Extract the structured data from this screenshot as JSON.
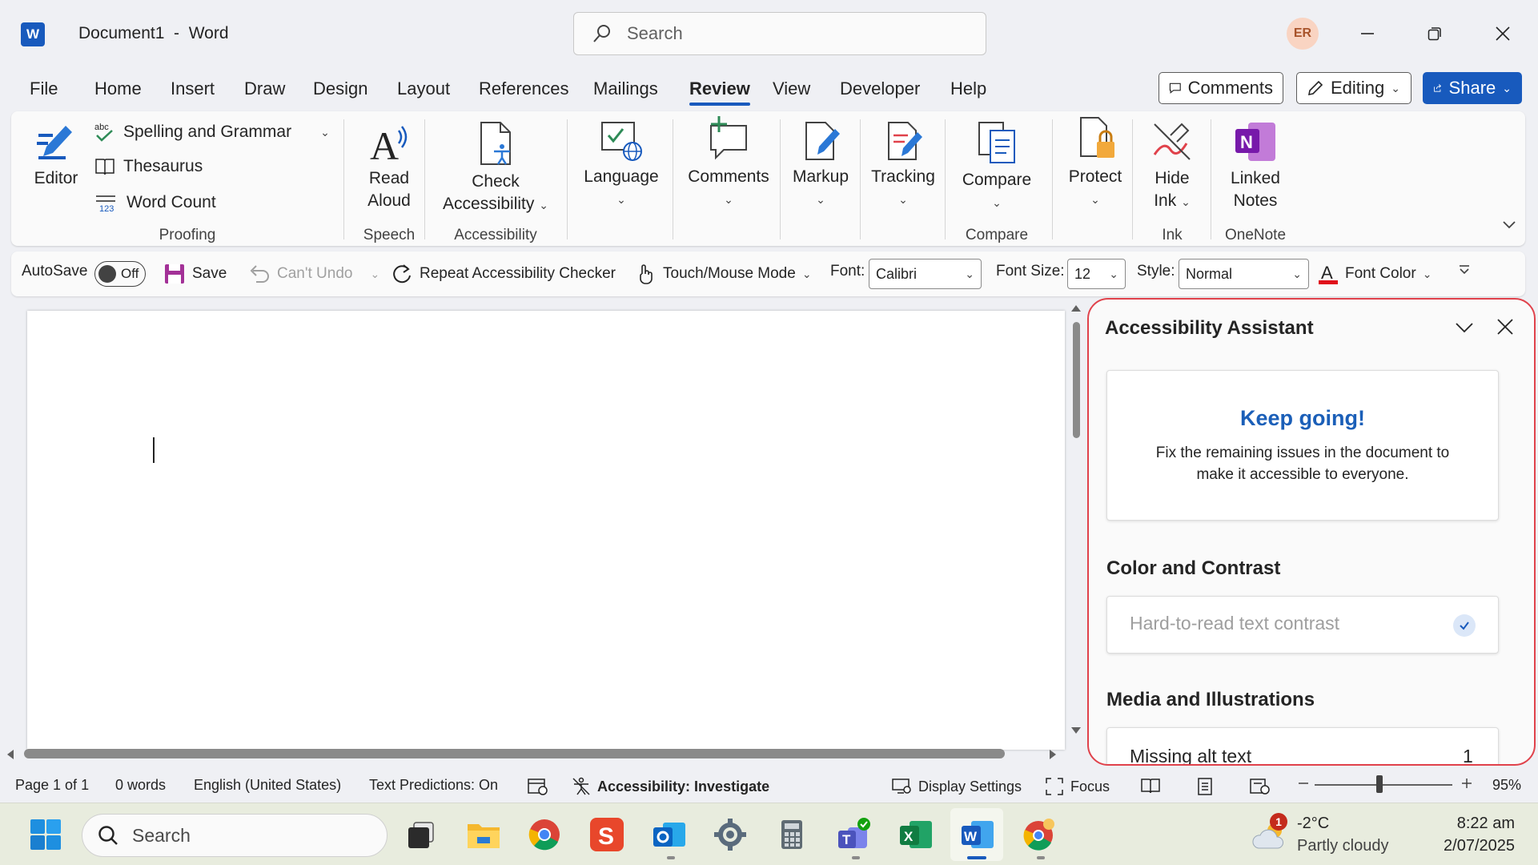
{
  "titlebar": {
    "app_logo": "W",
    "doc_title": "Document1  -  Word",
    "search_placeholder": "Search",
    "avatar": "ER"
  },
  "menu": {
    "tabs": [
      "File",
      "Home",
      "Insert",
      "Draw",
      "Design",
      "Layout",
      "References",
      "Mailings",
      "Review",
      "View",
      "Developer",
      "Help"
    ],
    "active_tab": "Review",
    "comments_label": "Comments",
    "editing_label": "Editing",
    "share_label": "Share"
  },
  "ribbon": {
    "editor": "Editor",
    "spelling": "Spelling and Grammar",
    "thesaurus": "Thesaurus",
    "word_count": "Word Count",
    "proofing": "Proofing",
    "read_aloud_1": "Read",
    "read_aloud_2": "Aloud",
    "speech": "Speech",
    "check_acc_1": "Check",
    "check_acc_2": "Accessibility",
    "accessibility": "Accessibility",
    "language": "Language",
    "comments": "Comments",
    "markup": "Markup",
    "tracking": "Tracking",
    "compare_btn": "Compare",
    "compare_group": "Compare",
    "protect": "Protect",
    "hide_ink_1": "Hide",
    "hide_ink_2": "Ink",
    "ink": "Ink",
    "linked_1": "Linked",
    "linked_2": "Notes",
    "onenote": "OneNote"
  },
  "qat": {
    "autosave": "AutoSave",
    "autosave_state": "Off",
    "save": "Save",
    "cant_undo": "Can't Undo",
    "repeat": "Repeat Accessibility Checker",
    "touch": "Touch/Mouse Mode",
    "font_label": "Font:",
    "font_value": "Calibri",
    "size_label": "Font Size:",
    "size_value": "12",
    "style_label": "Style:",
    "style_value": "Normal",
    "font_color": "Font Color"
  },
  "pane": {
    "title": "Accessibility Assistant",
    "keep_going": "Keep going!",
    "keep_going_body": "Fix the remaining issues in the document to make it accessible to everyone.",
    "color_section": "Color and Contrast",
    "contrast_item": "Hard-to-read text contrast",
    "media_section": "Media and Illustrations",
    "alt_text_item": "Missing alt text",
    "alt_text_count": "1"
  },
  "statusbar": {
    "page": "Page 1 of 1",
    "words": "0 words",
    "language": "English (United States)",
    "predictions": "Text Predictions: On",
    "accessibility": "Accessibility: Investigate",
    "display_settings": "Display Settings",
    "focus": "Focus",
    "zoom": "95%"
  },
  "taskbar": {
    "search": "Search",
    "weather_badge": "1",
    "temperature": "-2°C",
    "weather": "Partly cloudy",
    "time": "8:22 am",
    "date": "2/07/2025"
  },
  "colors": {
    "accent": "#185abd",
    "highlight_border": "#e0424b",
    "keep_going": "#1b5fb8"
  }
}
